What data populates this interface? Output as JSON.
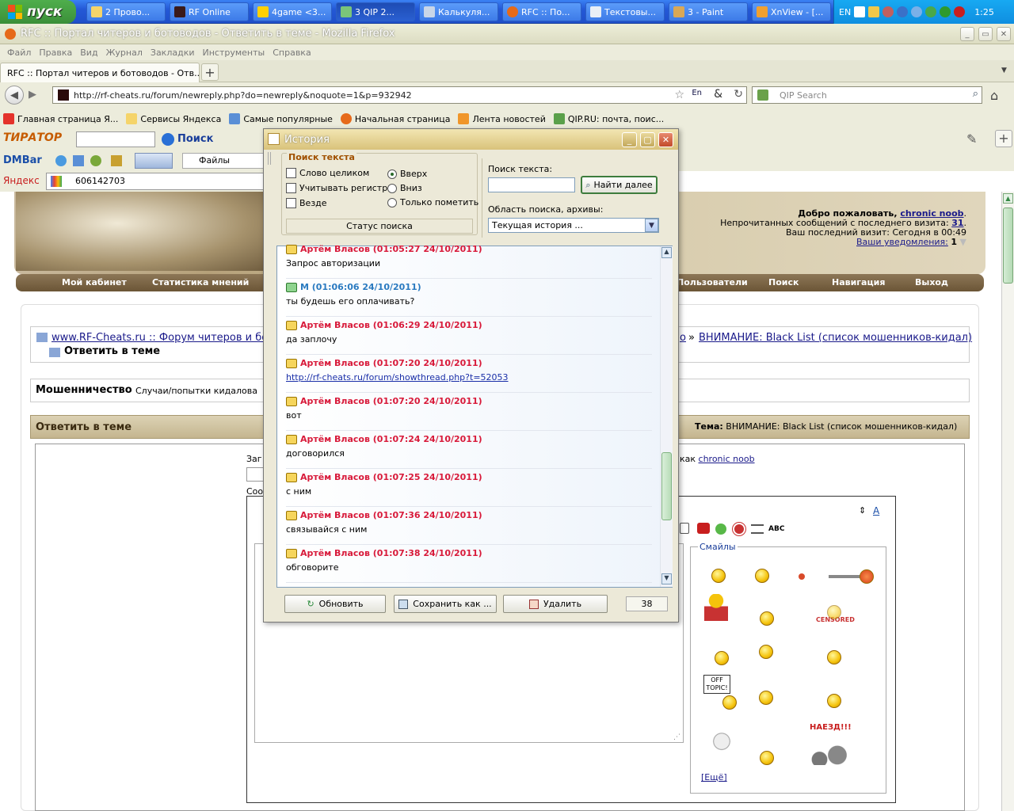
{
  "taskbar": {
    "start_label": "пуск",
    "items": [
      {
        "label": "2 Прово..."
      },
      {
        "label": "RF Online"
      },
      {
        "label": "4game <3..."
      },
      {
        "label": "3 QIP 2..."
      },
      {
        "label": "Калькуля..."
      },
      {
        "label": "RFC :: По..."
      },
      {
        "label": "Текстовы..."
      },
      {
        "label": "3 - Paint"
      },
      {
        "label": "XnView - [..."
      }
    ],
    "lang": "EN",
    "clock": "1:25"
  },
  "browser": {
    "title": "RFC :: Портал читеров и ботоводов - Ответить в теме - Mozilla Firefox",
    "menu": [
      "Файл",
      "Правка",
      "Вид",
      "Журнал",
      "Закладки",
      "Инструменты",
      "Справка"
    ],
    "tab_title": "RFC :: Портал читеров и ботоводов - Отв...",
    "url": "http://rf-cheats.ru/forum/newreply.php?do=newreply&noquote=1&p=932942",
    "search_placeholder": "QIP Search",
    "bookmarks": [
      "Главная страница Я...",
      "Сервисы Яндекса",
      "Самые популярные",
      "Начальная страница",
      "Лента новостей",
      "QIP.RU: почта, поис..."
    ],
    "toolbar_search_label": "Поиск",
    "dmbar_label": "DMBar",
    "files_label": "Файлы",
    "yandex_label": "Яндекс",
    "yandex_value": "606142703"
  },
  "forum": {
    "welcome": "Добро пожаловать,",
    "username": "chronic noob",
    "unread_text": "Непрочитанных сообщений с последнего визита:",
    "unread_count": "31",
    "last_visit": "Ваш последний визит: Сегодня в 00:49",
    "notifications_label": "Ваши уведомления:",
    "notifications_count": "1",
    "nav": [
      "Мой кабинет",
      "Статистика мнений",
      "Пользователи",
      "Поиск",
      "Навигация",
      "Выход"
    ],
    "breadcrumb_root": "www.RF-Cheats.ru :: Форум читеров и бо",
    "breadcrumb_tail_link": "о",
    "breadcrumb_last": "ВНИМАНИЕ: Black List (список мошенников-кидал)",
    "current_page": "Ответить в теме",
    "category_title": "Мошенничество",
    "category_desc": "Случаи/попытки кидалова",
    "reply_header": "Ответить в теме",
    "topic_label": "Тема:",
    "topic_value": "ВНИМАНИЕ: Black List (список мошенников-кидал)",
    "logged_as_prefix": "как",
    "form_label_title": "Заг",
    "form_label_message": "Соо",
    "smilies_title": "Смайлы",
    "more_smilies": "[Ещё]",
    "censored_text": "CENSORED",
    "offtopic_text": "OFF TOPIC!",
    "naezd_text": "НАЕЗД!!!"
  },
  "history": {
    "title": "История",
    "search_group_title": "Поиск текста",
    "opt_whole_word": "Слово целиком",
    "opt_case": "Учитывать регистр",
    "opt_everywhere": "Везде",
    "dir_up": "Вверх",
    "dir_down": "Вниз",
    "dir_mark_only": "Только пометить",
    "status_button": "Статус поиска",
    "search_text_label": "Поиск текста:",
    "find_next_button": "Найти далее",
    "scope_label": "Область поиска, архивы:",
    "scope_value": "Текущая история ...",
    "messages": [
      {
        "author": "Артём Власов (01:05:27 24/10/2011)",
        "text": "Запрос авторизации",
        "me": false,
        "link": false
      },
      {
        "author": "М (01:06:06 24/10/2011)",
        "text": "ты будешь его оплачивать?",
        "me": true,
        "link": false
      },
      {
        "author": "Артём Власов (01:06:29 24/10/2011)",
        "text": "да заплочу",
        "me": false,
        "link": false
      },
      {
        "author": "Артём Власов (01:07:20 24/10/2011)",
        "text": "http://rf-cheats.ru/forum/showthread.php?t=52053",
        "me": false,
        "link": true
      },
      {
        "author": "Артём Власов (01:07:20 24/10/2011)",
        "text": "вот",
        "me": false,
        "link": false
      },
      {
        "author": "Артём Власов (01:07:24 24/10/2011)",
        "text": "договорился",
        "me": false,
        "link": false
      },
      {
        "author": "Артём Власов (01:07:25 24/10/2011)",
        "text": "с ним",
        "me": false,
        "link": false
      },
      {
        "author": "Артём Власов (01:07:36 24/10/2011)",
        "text": "связывайся с ним",
        "me": false,
        "link": false
      },
      {
        "author": "Артём Власов (01:07:38 24/10/2011)",
        "text": "обговорите",
        "me": false,
        "link": false
      }
    ],
    "refresh_button": "Обновить",
    "save_button": "Сохранить как ...",
    "delete_button": "Удалить",
    "count": "38"
  },
  "colors": {
    "contact_color": "#d81a3a",
    "self_color": "#2a7ac0"
  }
}
